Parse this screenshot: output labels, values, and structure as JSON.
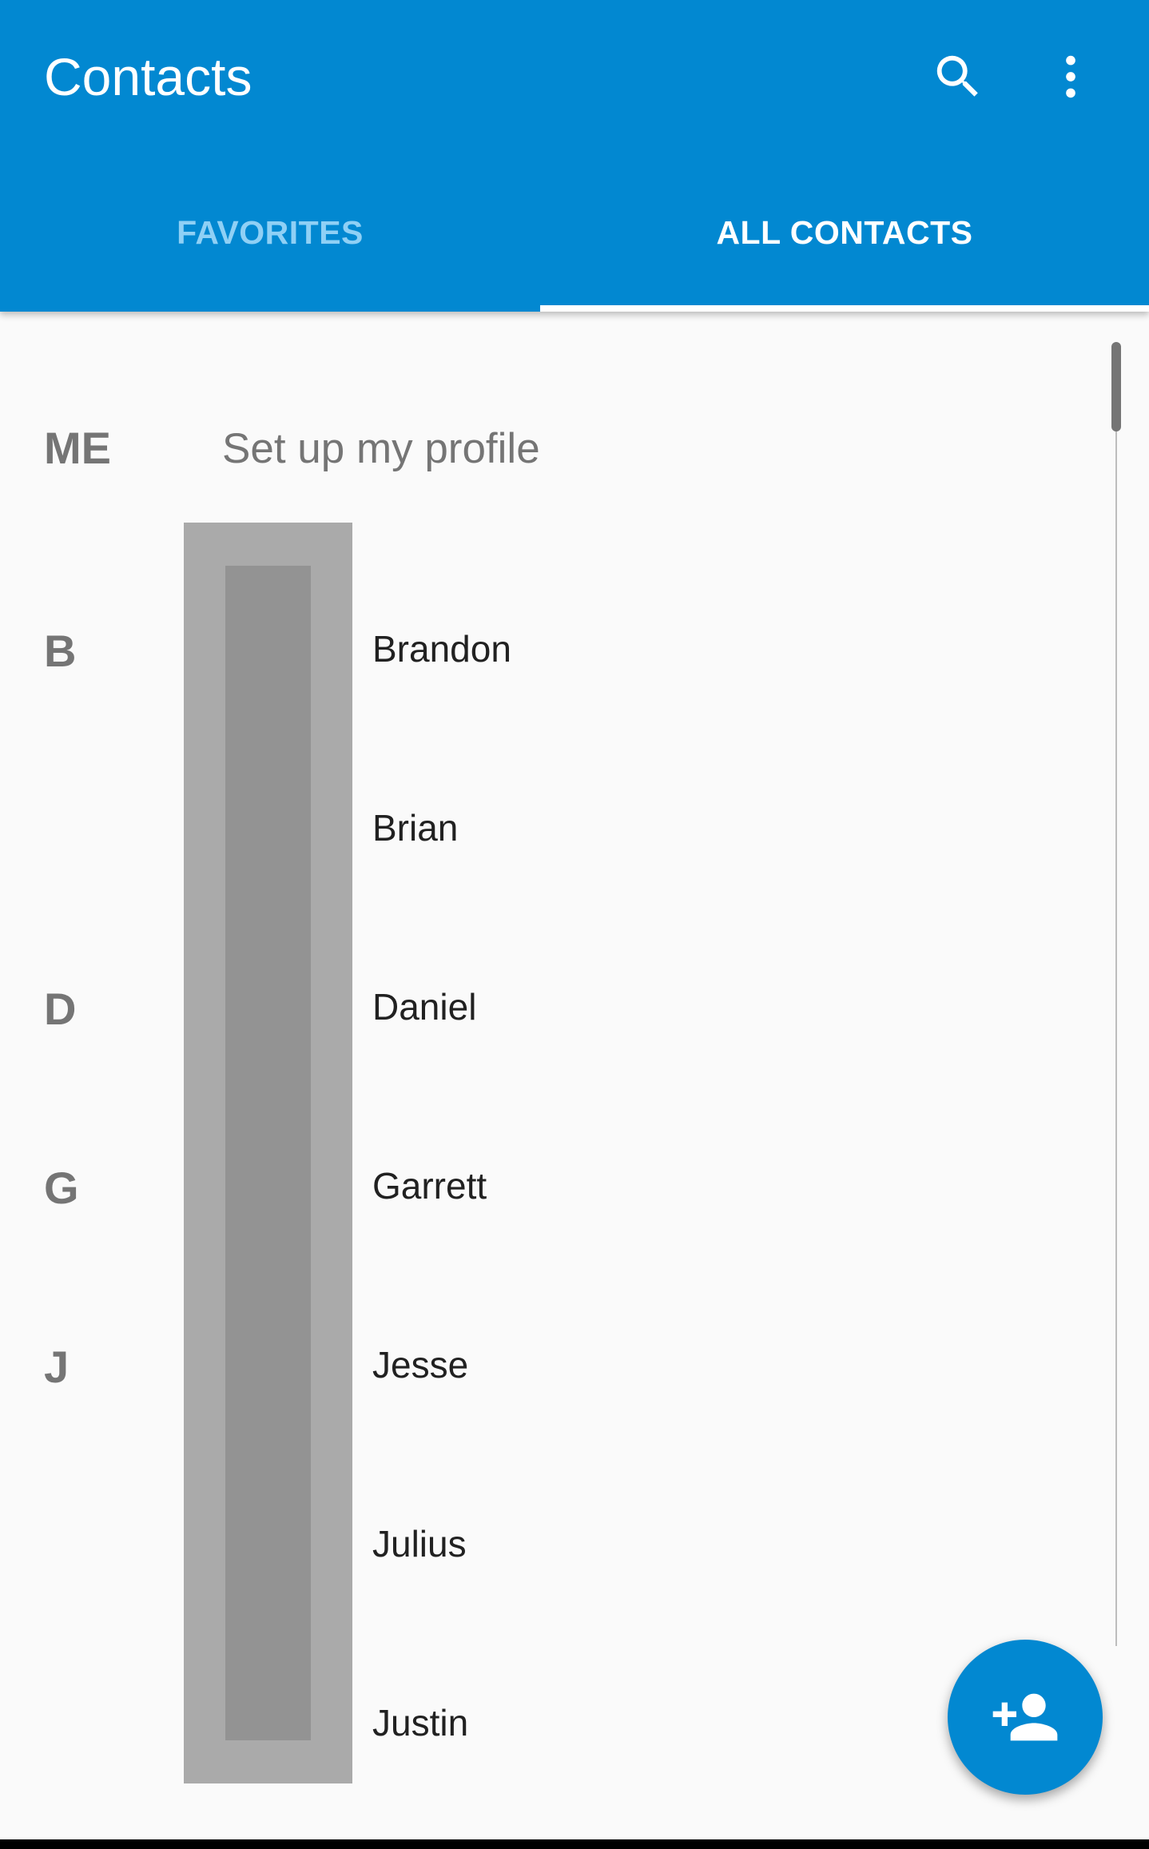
{
  "appbar": {
    "title": "Contacts",
    "search_icon": "search-icon",
    "more_icon": "more-vert-icon",
    "color": "#0288d1"
  },
  "tabs": [
    {
      "label": "FAVORITES",
      "selected": false
    },
    {
      "label": "ALL CONTACTS",
      "selected": true
    }
  ],
  "profile": {
    "section": "ME",
    "label": "Set up my profile"
  },
  "sections": [
    {
      "letter": "B"
    },
    {
      "letter": "D"
    },
    {
      "letter": "G"
    },
    {
      "letter": "J"
    }
  ],
  "contacts": [
    {
      "name": "Brandon"
    },
    {
      "name": "Brian"
    },
    {
      "name": "Daniel"
    },
    {
      "name": "Garrett"
    },
    {
      "name": "Jesse"
    },
    {
      "name": "Julius"
    },
    {
      "name": "Justin"
    }
  ],
  "fab": {
    "icon": "add-person-icon"
  }
}
